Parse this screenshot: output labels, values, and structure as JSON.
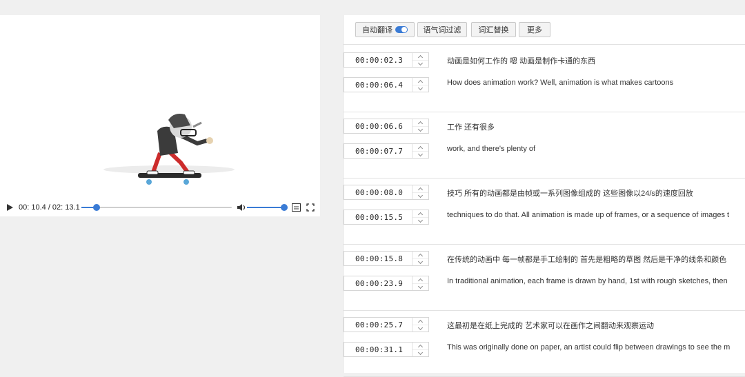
{
  "player": {
    "time_display": "00: 10.4 / 02: 13.1",
    "progress_fraction": 0.1,
    "volume_fraction": 1.0
  },
  "toolbar": {
    "auto_translate": "自动翻译",
    "filter_particles": "语气词过滤",
    "word_replace": "词汇替换",
    "more": "更多"
  },
  "segments": [
    {
      "start": "00:00:02.3",
      "end": "00:00:06.4",
      "source": "动画是如何工作的 嗯 动画是制作卡通的东西",
      "translation": "How does animation work? Well, animation is what makes cartoons"
    },
    {
      "start": "00:00:06.6",
      "end": "00:00:07.7",
      "source": "工作 还有很多",
      "translation": "work, and there's plenty of"
    },
    {
      "start": "00:00:08.0",
      "end": "00:00:15.5",
      "source": "技巧 所有的动画都是由帧或一系列图像组成的 这些图像以24/s的速度回放",
      "translation": "techniques to do that. All animation is made up of frames, or a sequence of images t"
    },
    {
      "start": "00:00:15.8",
      "end": "00:00:23.9",
      "source": "在传统的动画中 每一帧都是手工绘制的 首先是粗略的草图 然后是干净的线条和颜色",
      "translation": "In traditional animation, each frame is drawn by hand, 1st with rough sketches, then"
    },
    {
      "start": "00:00:25.7",
      "end": "00:00:31.1",
      "source": "这最初是在纸上完成的 艺术家可以在画作之间翻动来观察运动",
      "translation": "This was originally done on paper, an artist could flip between drawings to see the m"
    }
  ]
}
